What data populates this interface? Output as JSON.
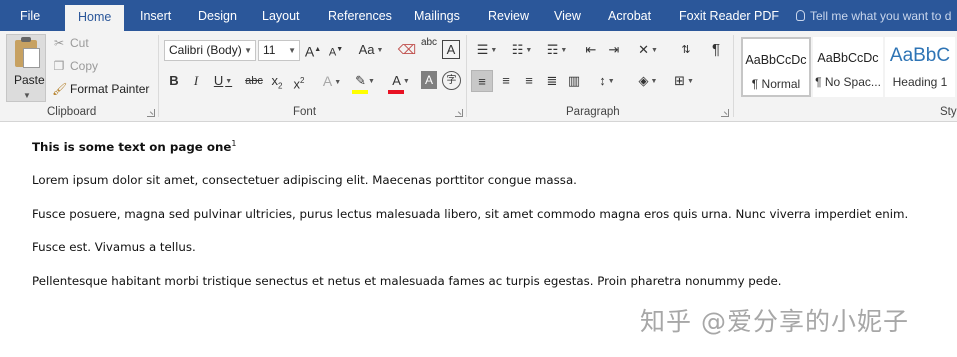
{
  "tabs": [
    {
      "label": "File",
      "active": false
    },
    {
      "label": "Home",
      "active": true
    },
    {
      "label": "Insert",
      "active": false
    },
    {
      "label": "Design",
      "active": false
    },
    {
      "label": "Layout",
      "active": false
    },
    {
      "label": "References",
      "active": false
    },
    {
      "label": "Mailings",
      "active": false
    },
    {
      "label": "Review",
      "active": false
    },
    {
      "label": "View",
      "active": false
    },
    {
      "label": "Acrobat",
      "active": false
    },
    {
      "label": "Foxit Reader PDF",
      "active": false
    }
  ],
  "tell_me": "Tell me what you want to d",
  "clipboard": {
    "paste": "Paste",
    "cut": "Cut",
    "copy": "Copy",
    "format_painter": "Format Painter",
    "group_label": "Clipboard"
  },
  "font": {
    "font_name": "Calibri (Body)",
    "font_size": "11",
    "group_label": "Font",
    "bold": "B",
    "italic": "I",
    "underline": "U",
    "strikethrough": "abc",
    "subscript": "x",
    "subscript_mark": "2",
    "superscript": "x",
    "superscript_mark": "2",
    "grow": "A",
    "shrink": "A",
    "change_case": "Aa",
    "phonetic": "abc",
    "char_border": "A",
    "text_effects": "A",
    "font_color": "A",
    "char_shading": "A",
    "enclose": "字",
    "highlight_color": "#ffff00",
    "font_color_bar": "#e81123"
  },
  "paragraph": {
    "group_label": "Paragraph",
    "show_marks": "¶"
  },
  "styles": {
    "group_label": "Sty",
    "items": [
      {
        "sample": "AaBbCcDc",
        "name": "¶ Normal",
        "selected": true
      },
      {
        "sample": "AaBbCcDc",
        "name": "¶ No Spac...",
        "selected": false
      },
      {
        "sample": "AaBbC",
        "name": "Heading 1",
        "selected": false
      }
    ]
  },
  "document": {
    "heading": "This is some text on page one",
    "footnote_ref": "1",
    "paragraphs": [
      "Lorem ipsum dolor sit amet, consectetuer adipiscing elit. Maecenas porttitor congue massa.",
      "Fusce posuere, magna sed pulvinar ultricies, purus lectus malesuada libero, sit amet commodo magna eros quis urna. Nunc viverra imperdiet enim.",
      "Fusce est. Vivamus a tellus.",
      "Pellentesque habitant morbi tristique senectus et netus et malesuada fames ac turpis egestas. Proin pharetra nonummy pede."
    ]
  },
  "watermark": "知乎 @爱分享的小妮子",
  "colors": {
    "title_bar": "#2b579a",
    "ribbon_bg": "#f3f3f3"
  }
}
